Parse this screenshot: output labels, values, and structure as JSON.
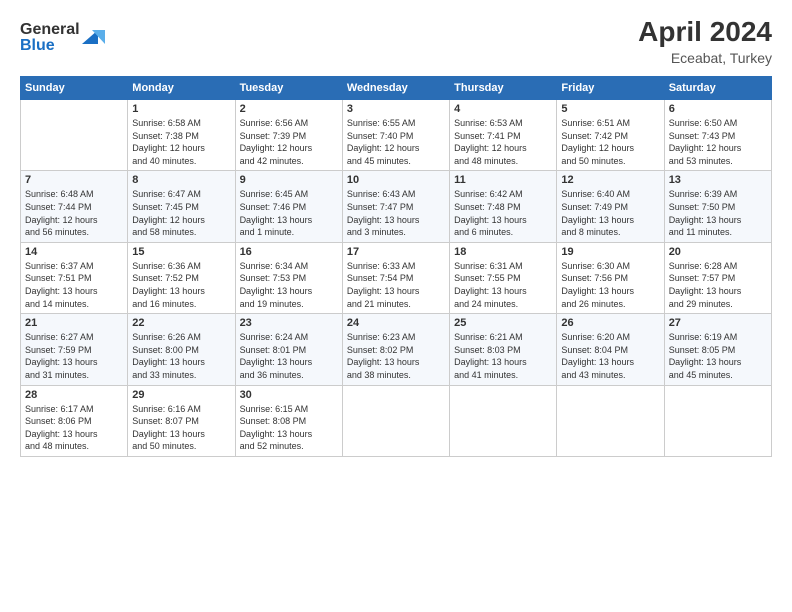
{
  "header": {
    "logo_line1": "General",
    "logo_line2": "Blue",
    "month_year": "April 2024",
    "location": "Eceabat, Turkey"
  },
  "days_of_week": [
    "Sunday",
    "Monday",
    "Tuesday",
    "Wednesday",
    "Thursday",
    "Friday",
    "Saturday"
  ],
  "weeks": [
    [
      {
        "day": "",
        "info": ""
      },
      {
        "day": "1",
        "info": "Sunrise: 6:58 AM\nSunset: 7:38 PM\nDaylight: 12 hours\nand 40 minutes."
      },
      {
        "day": "2",
        "info": "Sunrise: 6:56 AM\nSunset: 7:39 PM\nDaylight: 12 hours\nand 42 minutes."
      },
      {
        "day": "3",
        "info": "Sunrise: 6:55 AM\nSunset: 7:40 PM\nDaylight: 12 hours\nand 45 minutes."
      },
      {
        "day": "4",
        "info": "Sunrise: 6:53 AM\nSunset: 7:41 PM\nDaylight: 12 hours\nand 48 minutes."
      },
      {
        "day": "5",
        "info": "Sunrise: 6:51 AM\nSunset: 7:42 PM\nDaylight: 12 hours\nand 50 minutes."
      },
      {
        "day": "6",
        "info": "Sunrise: 6:50 AM\nSunset: 7:43 PM\nDaylight: 12 hours\nand 53 minutes."
      }
    ],
    [
      {
        "day": "7",
        "info": "Sunrise: 6:48 AM\nSunset: 7:44 PM\nDaylight: 12 hours\nand 56 minutes."
      },
      {
        "day": "8",
        "info": "Sunrise: 6:47 AM\nSunset: 7:45 PM\nDaylight: 12 hours\nand 58 minutes."
      },
      {
        "day": "9",
        "info": "Sunrise: 6:45 AM\nSunset: 7:46 PM\nDaylight: 13 hours\nand 1 minute."
      },
      {
        "day": "10",
        "info": "Sunrise: 6:43 AM\nSunset: 7:47 PM\nDaylight: 13 hours\nand 3 minutes."
      },
      {
        "day": "11",
        "info": "Sunrise: 6:42 AM\nSunset: 7:48 PM\nDaylight: 13 hours\nand 6 minutes."
      },
      {
        "day": "12",
        "info": "Sunrise: 6:40 AM\nSunset: 7:49 PM\nDaylight: 13 hours\nand 8 minutes."
      },
      {
        "day": "13",
        "info": "Sunrise: 6:39 AM\nSunset: 7:50 PM\nDaylight: 13 hours\nand 11 minutes."
      }
    ],
    [
      {
        "day": "14",
        "info": "Sunrise: 6:37 AM\nSunset: 7:51 PM\nDaylight: 13 hours\nand 14 minutes."
      },
      {
        "day": "15",
        "info": "Sunrise: 6:36 AM\nSunset: 7:52 PM\nDaylight: 13 hours\nand 16 minutes."
      },
      {
        "day": "16",
        "info": "Sunrise: 6:34 AM\nSunset: 7:53 PM\nDaylight: 13 hours\nand 19 minutes."
      },
      {
        "day": "17",
        "info": "Sunrise: 6:33 AM\nSunset: 7:54 PM\nDaylight: 13 hours\nand 21 minutes."
      },
      {
        "day": "18",
        "info": "Sunrise: 6:31 AM\nSunset: 7:55 PM\nDaylight: 13 hours\nand 24 minutes."
      },
      {
        "day": "19",
        "info": "Sunrise: 6:30 AM\nSunset: 7:56 PM\nDaylight: 13 hours\nand 26 minutes."
      },
      {
        "day": "20",
        "info": "Sunrise: 6:28 AM\nSunset: 7:57 PM\nDaylight: 13 hours\nand 29 minutes."
      }
    ],
    [
      {
        "day": "21",
        "info": "Sunrise: 6:27 AM\nSunset: 7:59 PM\nDaylight: 13 hours\nand 31 minutes."
      },
      {
        "day": "22",
        "info": "Sunrise: 6:26 AM\nSunset: 8:00 PM\nDaylight: 13 hours\nand 33 minutes."
      },
      {
        "day": "23",
        "info": "Sunrise: 6:24 AM\nSunset: 8:01 PM\nDaylight: 13 hours\nand 36 minutes."
      },
      {
        "day": "24",
        "info": "Sunrise: 6:23 AM\nSunset: 8:02 PM\nDaylight: 13 hours\nand 38 minutes."
      },
      {
        "day": "25",
        "info": "Sunrise: 6:21 AM\nSunset: 8:03 PM\nDaylight: 13 hours\nand 41 minutes."
      },
      {
        "day": "26",
        "info": "Sunrise: 6:20 AM\nSunset: 8:04 PM\nDaylight: 13 hours\nand 43 minutes."
      },
      {
        "day": "27",
        "info": "Sunrise: 6:19 AM\nSunset: 8:05 PM\nDaylight: 13 hours\nand 45 minutes."
      }
    ],
    [
      {
        "day": "28",
        "info": "Sunrise: 6:17 AM\nSunset: 8:06 PM\nDaylight: 13 hours\nand 48 minutes."
      },
      {
        "day": "29",
        "info": "Sunrise: 6:16 AM\nSunset: 8:07 PM\nDaylight: 13 hours\nand 50 minutes."
      },
      {
        "day": "30",
        "info": "Sunrise: 6:15 AM\nSunset: 8:08 PM\nDaylight: 13 hours\nand 52 minutes."
      },
      {
        "day": "",
        "info": ""
      },
      {
        "day": "",
        "info": ""
      },
      {
        "day": "",
        "info": ""
      },
      {
        "day": "",
        "info": ""
      }
    ]
  ]
}
